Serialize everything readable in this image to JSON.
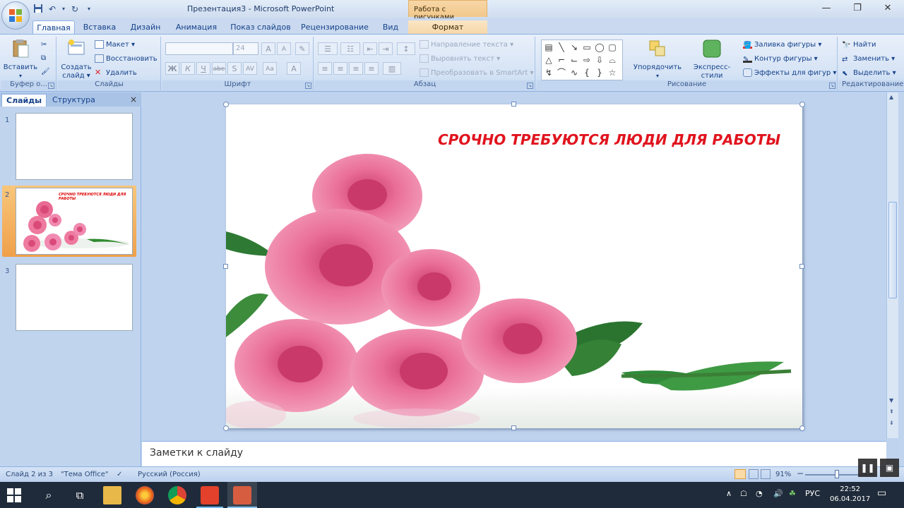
{
  "window": {
    "title": "Презентация3 - Microsoft PowerPoint",
    "context_tab_header": "Работа с рисунками",
    "minimize": "—",
    "maximize": "❐",
    "close": "✕"
  },
  "tabs": [
    "Главная",
    "Вставка",
    "Дизайн",
    "Анимация",
    "Показ слайдов",
    "Рецензирование",
    "Вид",
    "Формат"
  ],
  "ribbon": {
    "clipboard": {
      "paste": "Вставить",
      "label": "Буфер о..."
    },
    "slides": {
      "new_slide_l1": "Создать",
      "new_slide_l2": "слайд",
      "layout": "Макет",
      "reset": "Восстановить",
      "delete": "Удалить",
      "label": "Слайды"
    },
    "font": {
      "font_size": "24",
      "bold": "Ж",
      "italic": "К",
      "underline": "Ч",
      "strike": "abe",
      "shadow": "S",
      "spacing": "AV",
      "case": "Aa",
      "grow": "A",
      "shrink": "A",
      "label": "Шрифт"
    },
    "paragraph": {
      "text_direction": "Направление текста",
      "align_text": "Выровнять текст",
      "smartart": "Преобразовать в SmartArt",
      "label": "Абзац"
    },
    "drawing": {
      "arrange": "Упорядочить",
      "quick_styles": "Экспресс-стили",
      "shape_fill": "Заливка фигуры",
      "shape_outline": "Контур фигуры",
      "shape_effects": "Эффекты для фигур",
      "label": "Рисование"
    },
    "editing": {
      "find": "Найти",
      "replace": "Заменить",
      "select": "Выделить",
      "label": "Редактирование"
    }
  },
  "left_panel": {
    "tab_slides": "Слайды",
    "tab_outline": "Структура",
    "close": "×",
    "thumbs": [
      {
        "num": "1"
      },
      {
        "num": "2",
        "mini_title": "СРОЧНО ТРЕБУЮТСЯ ЛЮДИ ДЛЯ РАБОТЫ"
      },
      {
        "num": "3"
      }
    ]
  },
  "slide": {
    "title": "СРОЧНО ТРЕБУЮТСЯ ЛЮДИ ДЛЯ РАБОТЫ",
    "title_color": "#e0141e",
    "image": "pink-roses-bouquet"
  },
  "notes": {
    "placeholder": "Заметки к слайду"
  },
  "status": {
    "slide_info": "Слайд 2 из 3",
    "theme": "\"Тема Office\"",
    "language": "Русский (Россия)",
    "zoom": "91%",
    "zoom_minus": "−",
    "zoom_plus": "+"
  },
  "taskbar": {
    "language": "РУС",
    "time": "22:52",
    "date": "06.04.2017"
  },
  "colors": {
    "ribbon_bg": "#d5e3f5",
    "accent_orange": "#f0a04a",
    "taskbar": "#1f2b3a"
  }
}
